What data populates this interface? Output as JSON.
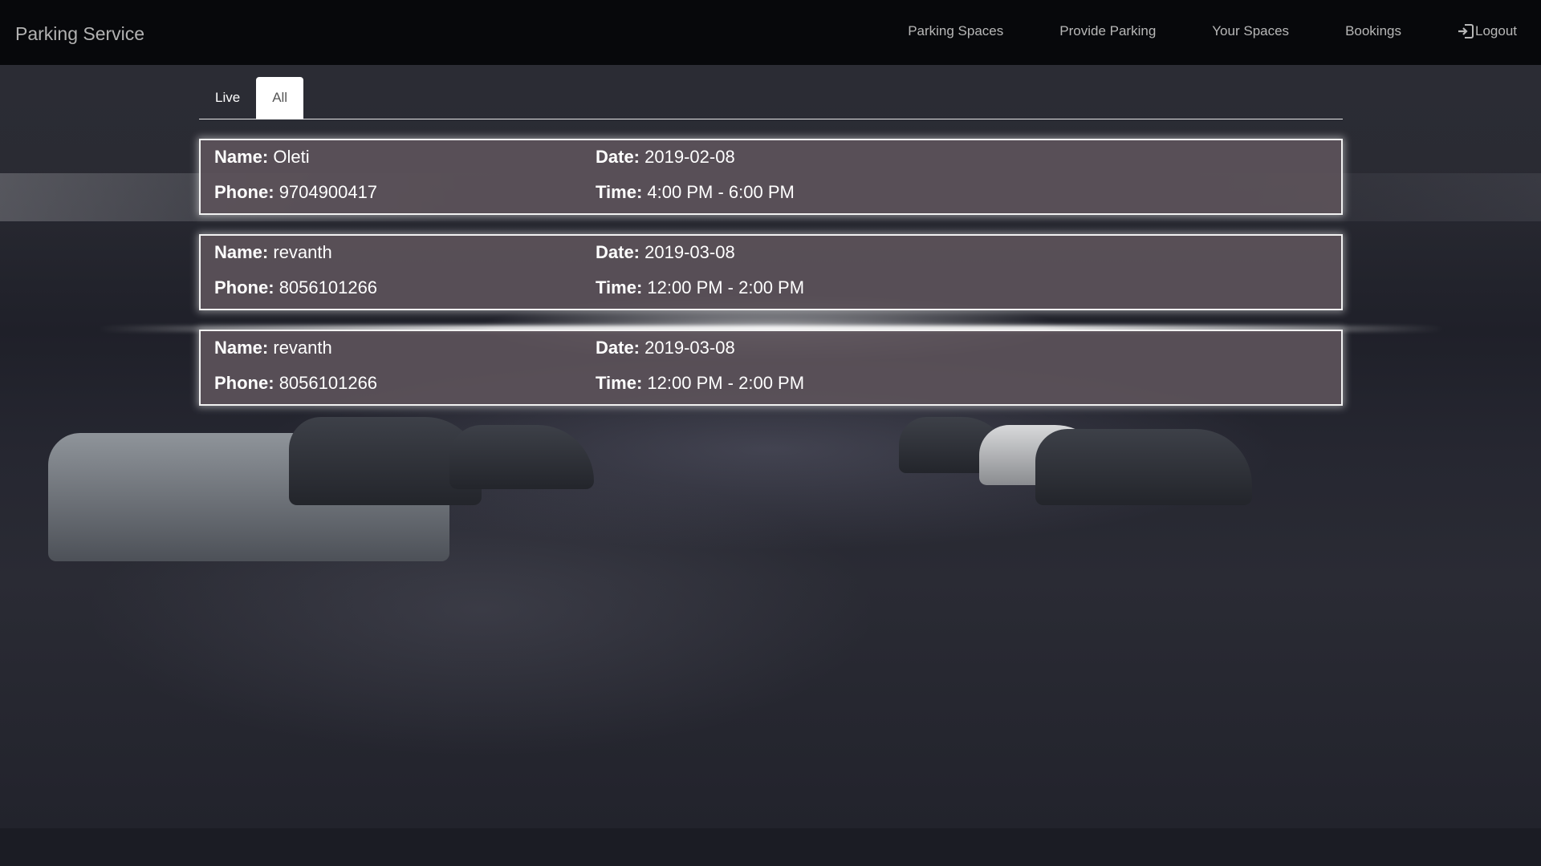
{
  "navbar": {
    "brand": "Parking Service",
    "links": [
      {
        "label": "Parking Spaces"
      },
      {
        "label": "Provide Parking"
      },
      {
        "label": "Your Spaces"
      },
      {
        "label": "Bookings"
      },
      {
        "label": "Logout",
        "icon": "logout-icon"
      }
    ]
  },
  "tabs": [
    {
      "label": "Live",
      "active": false
    },
    {
      "label": "All",
      "active": true
    }
  ],
  "labels": {
    "name": "Name:",
    "phone": "Phone:",
    "date": "Date:",
    "time": "Time:"
  },
  "bookings": [
    {
      "name": "Oleti",
      "phone": "9704900417",
      "date": "2019-02-08",
      "time": "4:00 PM - 6:00 PM"
    },
    {
      "name": "revanth",
      "phone": "8056101266",
      "date": "2019-03-08",
      "time": "12:00 PM - 2:00 PM"
    },
    {
      "name": "revanth",
      "phone": "8056101266",
      "date": "2019-03-08",
      "time": "12:00 PM - 2:00 PM"
    }
  ],
  "colors": {
    "navbar_bg": "#07080b",
    "card_bg": "#5c525a",
    "card_border": "#f2f2f2"
  }
}
